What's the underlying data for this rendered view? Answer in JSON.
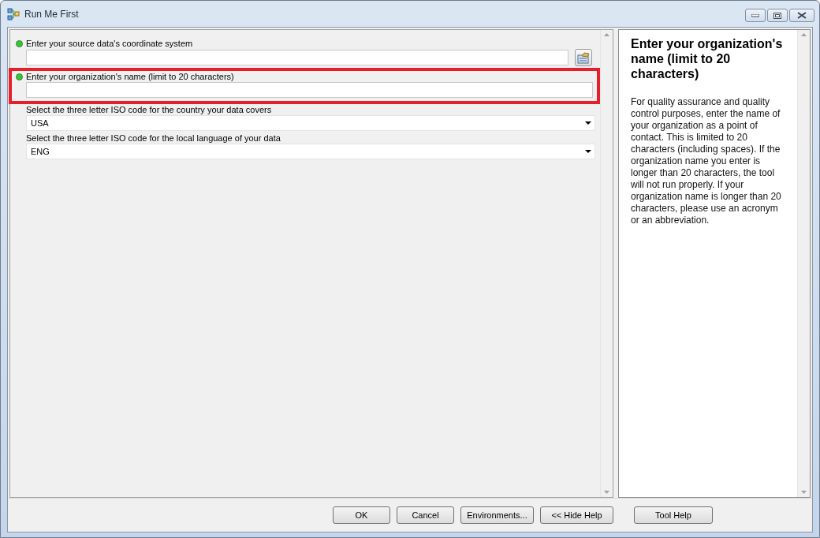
{
  "window": {
    "title": "Run Me First"
  },
  "parameters": [
    {
      "kind": "browse",
      "label": "Enter your source data's coordinate system",
      "required": true,
      "highlighted": false
    },
    {
      "kind": "text",
      "label": "Enter your organization's name (limit to 20 characters)",
      "required": true,
      "highlighted": true
    },
    {
      "kind": "dropdown",
      "label": "Select the three letter ISO code for the country your data covers",
      "required": false,
      "highlighted": false,
      "value": "USA"
    },
    {
      "kind": "dropdown",
      "label": "Select the three letter ISO code for the local language of your data",
      "required": false,
      "highlighted": false,
      "value": "ENG"
    }
  ],
  "help": {
    "title": "Enter your organization's name (limit to 20 characters)",
    "body": "For quality assurance and quality control purposes, enter the name of your organization as a point of contact. This is limited to 20 characters (including spaces). If the organization name you enter is longer than 20 characters, the tool will not run properly. If your organization name is longer than 20 characters, please use an acronym or an abbreviation."
  },
  "buttons": [
    {
      "label": "OK",
      "kind": "main"
    },
    {
      "label": "Cancel",
      "kind": "main"
    },
    {
      "label": "Environments...",
      "kind": "main"
    },
    {
      "label": "<< Hide Help",
      "kind": "main"
    },
    {
      "label": "Tool Help",
      "kind": "aside"
    }
  ]
}
